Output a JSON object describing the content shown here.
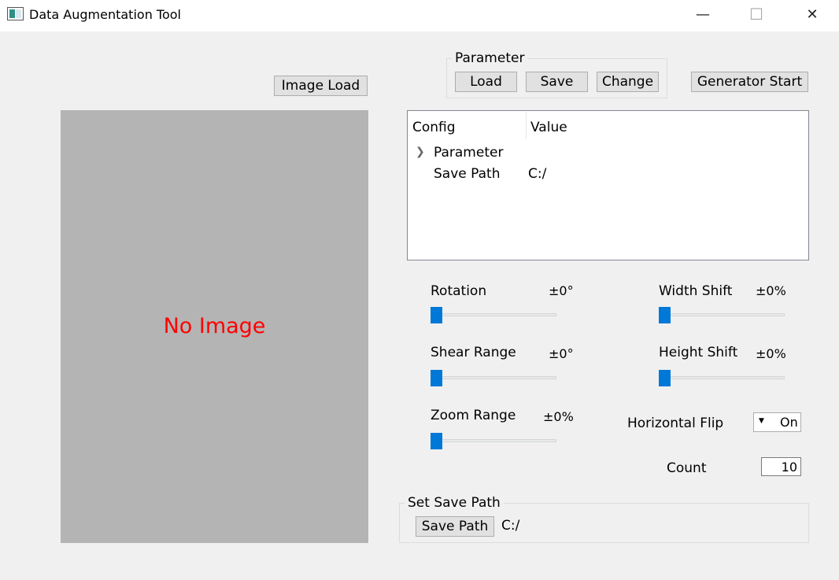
{
  "window": {
    "title": "Data Augmentation Tool",
    "minimize_glyph": "—",
    "maximize_glyph": "☐",
    "close_glyph": "✕"
  },
  "toolbar": {
    "image_load_label": "Image Load",
    "parameter_group_title": "Parameter",
    "load_label": "Load",
    "save_label": "Save",
    "change_label": "Change",
    "generator_start_label": "Generator Start"
  },
  "image_panel": {
    "placeholder_text": "No Image"
  },
  "config_tree": {
    "columns": [
      "Config",
      "Value"
    ],
    "rows": [
      {
        "config": "Parameter",
        "value": "",
        "expandable": true
      },
      {
        "config": "Save Path",
        "value": "C:/",
        "expandable": false
      }
    ]
  },
  "params": {
    "rotation": {
      "label": "Rotation",
      "value_text": "±0°",
      "slider_value": 0
    },
    "shear_range": {
      "label": "Shear Range",
      "value_text": "±0°",
      "slider_value": 0
    },
    "zoom_range": {
      "label": "Zoom Range",
      "value_text": "±0%",
      "slider_value": 0
    },
    "width_shift": {
      "label": "Width Shift",
      "value_text": "±0%",
      "slider_value": 0
    },
    "height_shift": {
      "label": "Height Shift",
      "value_text": "±0%",
      "slider_value": 0
    },
    "horizontal_flip": {
      "label": "Horizontal Flip",
      "selected": "On"
    },
    "count": {
      "label": "Count",
      "value": "10"
    }
  },
  "save_path_group": {
    "title": "Set Save Path",
    "button_label": "Save Path",
    "path": "C:/"
  },
  "colors": {
    "accent": "#0078d7",
    "no_image_text": "#ff0000",
    "image_panel_bg": "#b4b4b4"
  }
}
